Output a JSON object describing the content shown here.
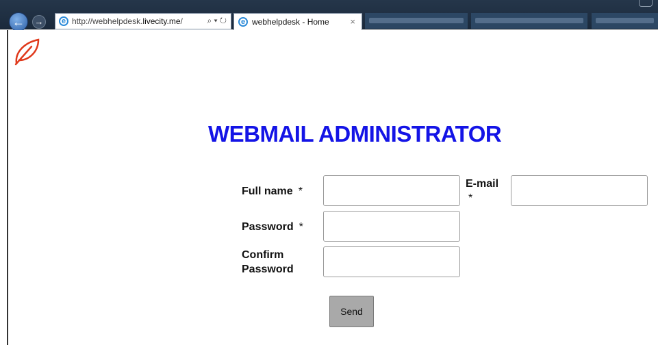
{
  "browser": {
    "url_prefix": "http://webhelpdesk.",
    "url_host": "livecity.me",
    "url_suffix": "/",
    "search_refresh": "⌕ ▾ ↻",
    "tab_title": "webhelpdesk - Home",
    "tab_close": "×",
    "back_glyph": "←",
    "forward_glyph": "→"
  },
  "page": {
    "heading": "WEBMAIL ADMINISTRATOR",
    "form": {
      "full_name_label": "Full name",
      "email_label": "E-mail",
      "password_label": "Password",
      "confirm_label_line1": "Confirm",
      "confirm_label_line2": "Password",
      "required_mark": "*",
      "send_label": "Send",
      "full_name_value": "",
      "email_value": "",
      "password_value": "",
      "confirm_value": ""
    }
  },
  "colors": {
    "heading": "#1414e6",
    "logo": "#e0391b",
    "button": "#a9a9a9"
  },
  "icons": [
    "back-arrow-icon",
    "forward-arrow-icon",
    "ie-icon",
    "leaf-logo-icon"
  ]
}
